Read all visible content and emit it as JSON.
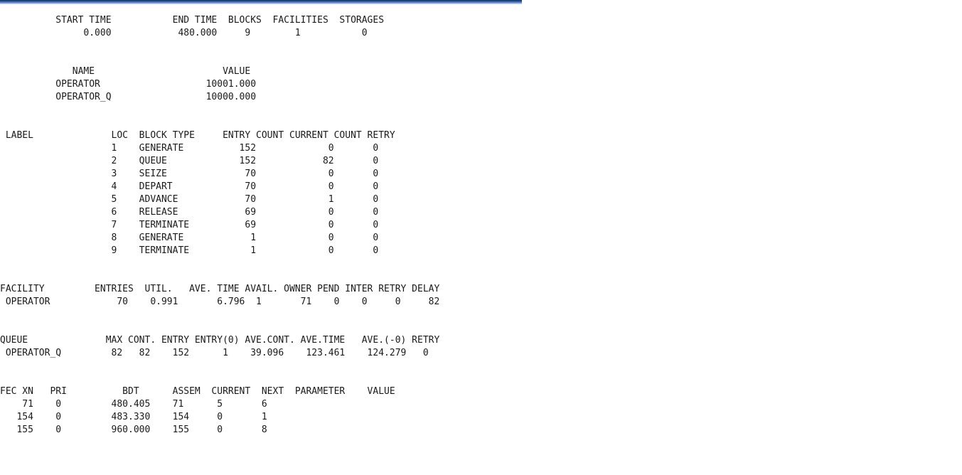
{
  "header_bar": {
    "color": "#3f6bb3"
  },
  "report": {
    "summary": {
      "header": "          START TIME           END TIME  BLOCKS  FACILITIES  STORAGES",
      "row": "               0.000            480.000     9        1           0"
    },
    "names": {
      "header": "             NAME                       VALUE",
      "rows": [
        "          OPERATOR                   10001.000",
        "          OPERATOR_Q                 10000.000"
      ]
    },
    "blocks": {
      "header": " LABEL              LOC  BLOCK TYPE     ENTRY COUNT CURRENT COUNT RETRY",
      "rows": [
        "                    1    GENERATE          152             0       0",
        "                    2    QUEUE             152            82       0",
        "                    3    SEIZE              70             0       0",
        "                    4    DEPART             70             0       0",
        "                    5    ADVANCE            70             1       0",
        "                    6    RELEASE            69             0       0",
        "                    7    TERMINATE          69             0       0",
        "                    8    GENERATE            1             0       0",
        "                    9    TERMINATE           1             0       0"
      ]
    },
    "facility": {
      "header": "FACILITY         ENTRIES  UTIL.   AVE. TIME AVAIL. OWNER PEND INTER RETRY DELAY",
      "row": " OPERATOR            70    0.991       6.796  1       71    0    0     0     82"
    },
    "queue": {
      "header": "QUEUE              MAX CONT. ENTRY ENTRY(0) AVE.CONT. AVE.TIME   AVE.(-0) RETRY",
      "row": " OPERATOR_Q         82   82    152      1    39.096    123.461    124.279   0"
    },
    "fec": {
      "header": "FEC XN   PRI          BDT      ASSEM  CURRENT  NEXT  PARAMETER    VALUE",
      "rows": [
        "    71    0         480.405    71      5       6",
        "   154    0         483.330    154     0       1",
        "   155    0         960.000    155     0       8"
      ]
    }
  }
}
